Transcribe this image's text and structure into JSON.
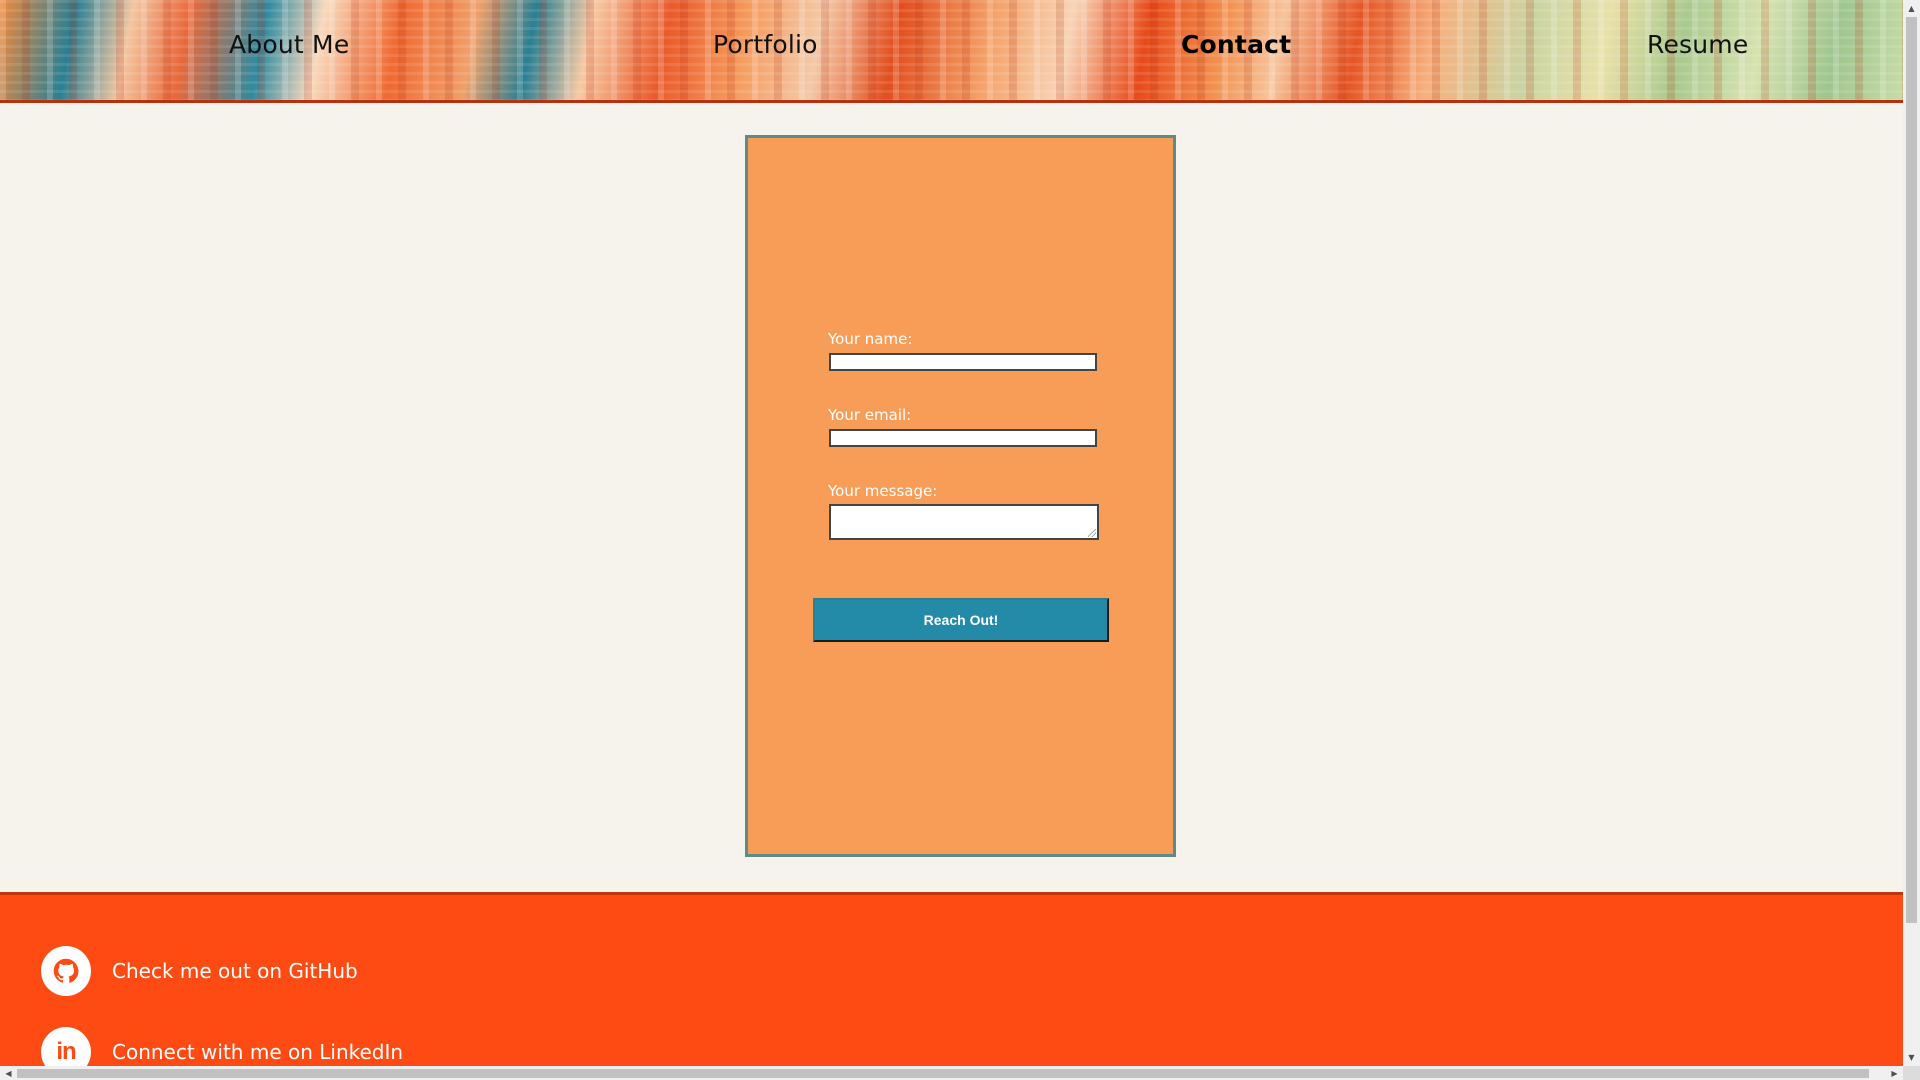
{
  "nav": {
    "items": [
      {
        "label": "About Me"
      },
      {
        "label": "Portfolio"
      },
      {
        "label": "Contact"
      },
      {
        "label": "Resume"
      }
    ],
    "active": "Contact"
  },
  "form": {
    "name_label": "Your name:",
    "name_value": "",
    "email_label": "Your email:",
    "email_value": "",
    "message_label": "Your message:",
    "message_value": "",
    "submit_label": "Reach Out!"
  },
  "footer": {
    "links": [
      {
        "icon": "github-icon",
        "label": "Check me out on GitHub"
      },
      {
        "icon": "linkedin-icon",
        "label": "Connect with me on LinkedIn"
      }
    ]
  },
  "colors": {
    "page_background": "#f6f3ec",
    "card_background": "#f79d58",
    "card_border": "#5f8a85",
    "button_background": "#238aa8",
    "footer_background": "#fe4b14",
    "header_border": "#b8300f"
  },
  "scrollbars": {
    "vertical": true,
    "horizontal": true
  }
}
